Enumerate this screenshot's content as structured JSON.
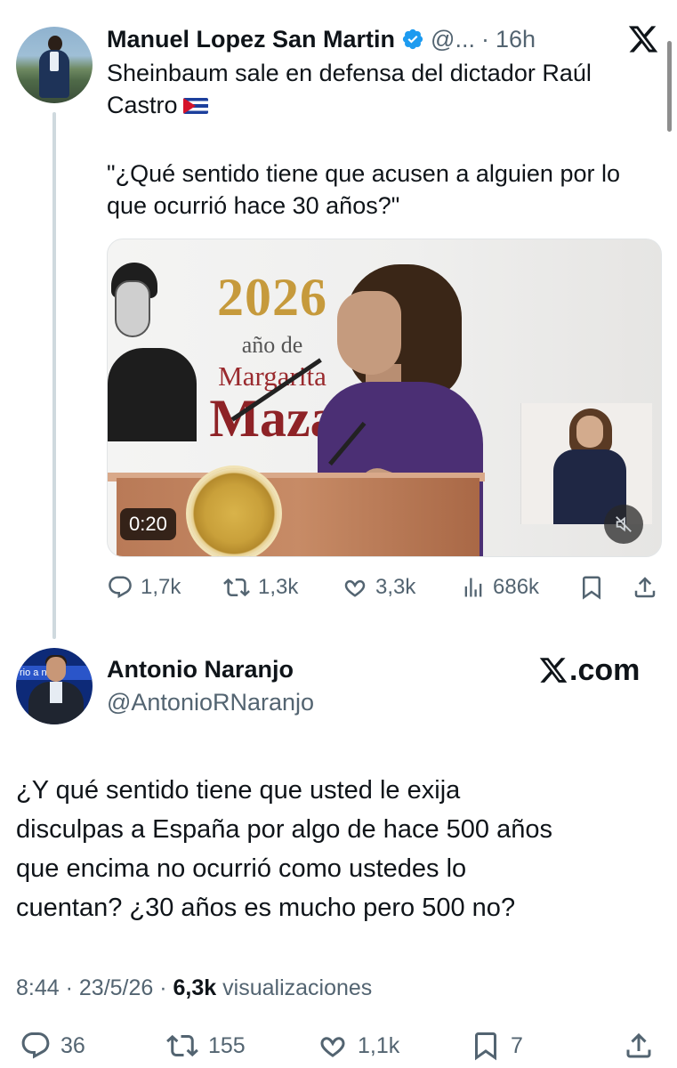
{
  "parent_tweet": {
    "author_name": "Manuel Lopez San Martin",
    "handle_truncated": "@...",
    "separator": "·",
    "time": "16h",
    "text_lines": [
      "Sheinbaum sale en defensa del dictador Raúl",
      "Castro",
      "\"¿Qué sentido tiene que acusen a alguien por lo",
      "que ocurrió hace 30 años?\""
    ],
    "media": {
      "slide_year": "2026",
      "slide_line2": "año de",
      "slide_line3": "Margarita",
      "slide_line4": "Maza",
      "duration": "0:20"
    },
    "actions": {
      "replies": "1,7k",
      "reposts": "1,3k",
      "likes": "3,3k",
      "views": "686k"
    }
  },
  "main_tweet": {
    "author_name": "Antonio Naranjo",
    "handle": "@AntonioRNaranjo",
    "source_label": ".com",
    "avatar_band_text": "rio  a no",
    "text_lines": [
      "¿Y qué sentido tiene que usted le exija",
      "disculpas a España por algo de hace 500 años",
      "que encima no ocurrió como ustedes lo",
      "cuentan? ¿30 años es mucho pero 500 no?"
    ],
    "meta": {
      "time": "8:44",
      "separator": " · ",
      "date": "23/5/26",
      "separator2": " · ",
      "views_count": "6,3k",
      "views_label": " visualizaciones"
    },
    "actions": {
      "replies": "36",
      "reposts": "155",
      "likes": "1,1k",
      "bookmarks": "7"
    }
  },
  "colors": {
    "text_primary": "#0f1419",
    "text_secondary": "#536471",
    "verified_blue": "#1d9bf0",
    "thread_line": "#cfd9de"
  },
  "icons": [
    "verified-icon",
    "x-logo-icon",
    "cuba-flag-icon",
    "mute-icon",
    "reply-icon",
    "repost-icon",
    "like-icon",
    "views-icon",
    "bookmark-icon",
    "share-icon"
  ]
}
